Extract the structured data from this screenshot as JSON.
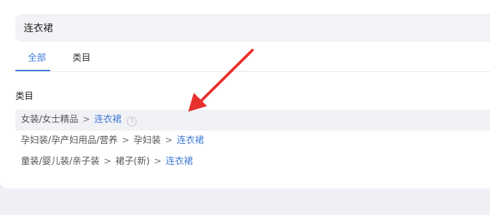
{
  "search": {
    "value": "连衣裙"
  },
  "tabs": [
    {
      "label": "全部",
      "active": true
    },
    {
      "label": "类目",
      "active": false
    }
  ],
  "section": {
    "title": "类目"
  },
  "results": [
    {
      "path": [
        "女装/女士精品"
      ],
      "leaf": "连衣裙",
      "sep": ">",
      "help_icon": "question-circle-icon"
    },
    {
      "path": [
        "孕妇装/孕产妇用品/营养",
        "孕妇装"
      ],
      "leaf": "连衣裙",
      "sep": ">"
    },
    {
      "path": [
        "童装/婴儿装/亲子装",
        "裙子(新)"
      ],
      "leaf": "连衣裙",
      "sep": ">"
    }
  ],
  "colors": {
    "accent": "#3f7bd6",
    "annotation_arrow": "#e8302e"
  }
}
